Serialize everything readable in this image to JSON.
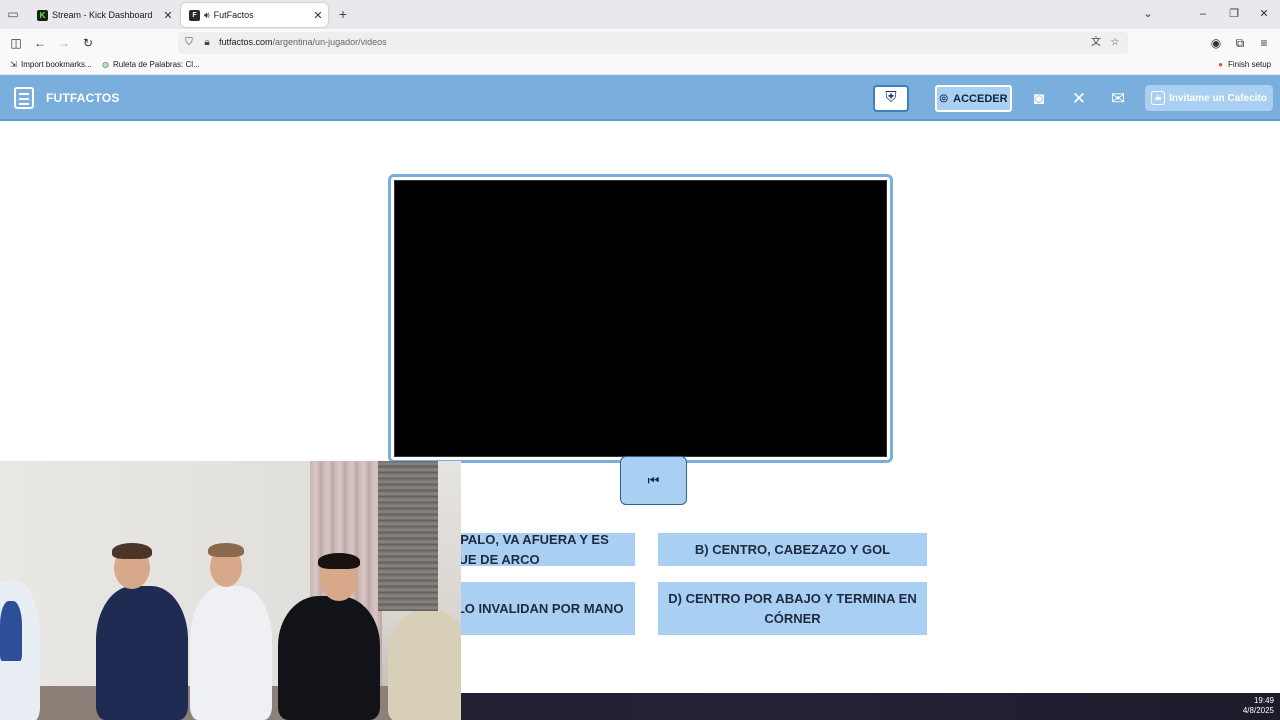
{
  "browser": {
    "tabs": [
      {
        "title": "Stream - Kick Dashboard",
        "favicon": "K",
        "active": false
      },
      {
        "title": "FutFactos",
        "favicon": "F",
        "active": true
      }
    ],
    "url_host": "futfactos.com",
    "url_path": "/argentina/un-jugador/videos",
    "bookmarks": [
      {
        "label": "Import bookmarks..."
      },
      {
        "label": "Ruleta de Palabras: Cl..."
      }
    ],
    "finish_setup": "Finish setup"
  },
  "site": {
    "logo_text": "FUTFACTOS",
    "login_label": "ACCEDER",
    "cafecito_label": "Invitame un Cafecito"
  },
  "quiz": {
    "answers": [
      {
        "text": "A) PEGA EN EL PALO, VA AFUERA Y ES SAQUE DE ARCO"
      },
      {
        "text": "B) CENTRO, CABEZAZO Y GOL"
      },
      {
        "text": "C) ES GOL PERO LO INVALIDAN POR MANO"
      },
      {
        "text": "D) CENTRO POR ABAJO Y TERMINA EN CÓRNER"
      }
    ]
  },
  "taskbar": {
    "time": "19:49",
    "date": "4/8/2025"
  },
  "colors": {
    "header_bg": "#7aaedc",
    "button_bg": "#a9cff2",
    "frame_border": "#7aaedc"
  }
}
